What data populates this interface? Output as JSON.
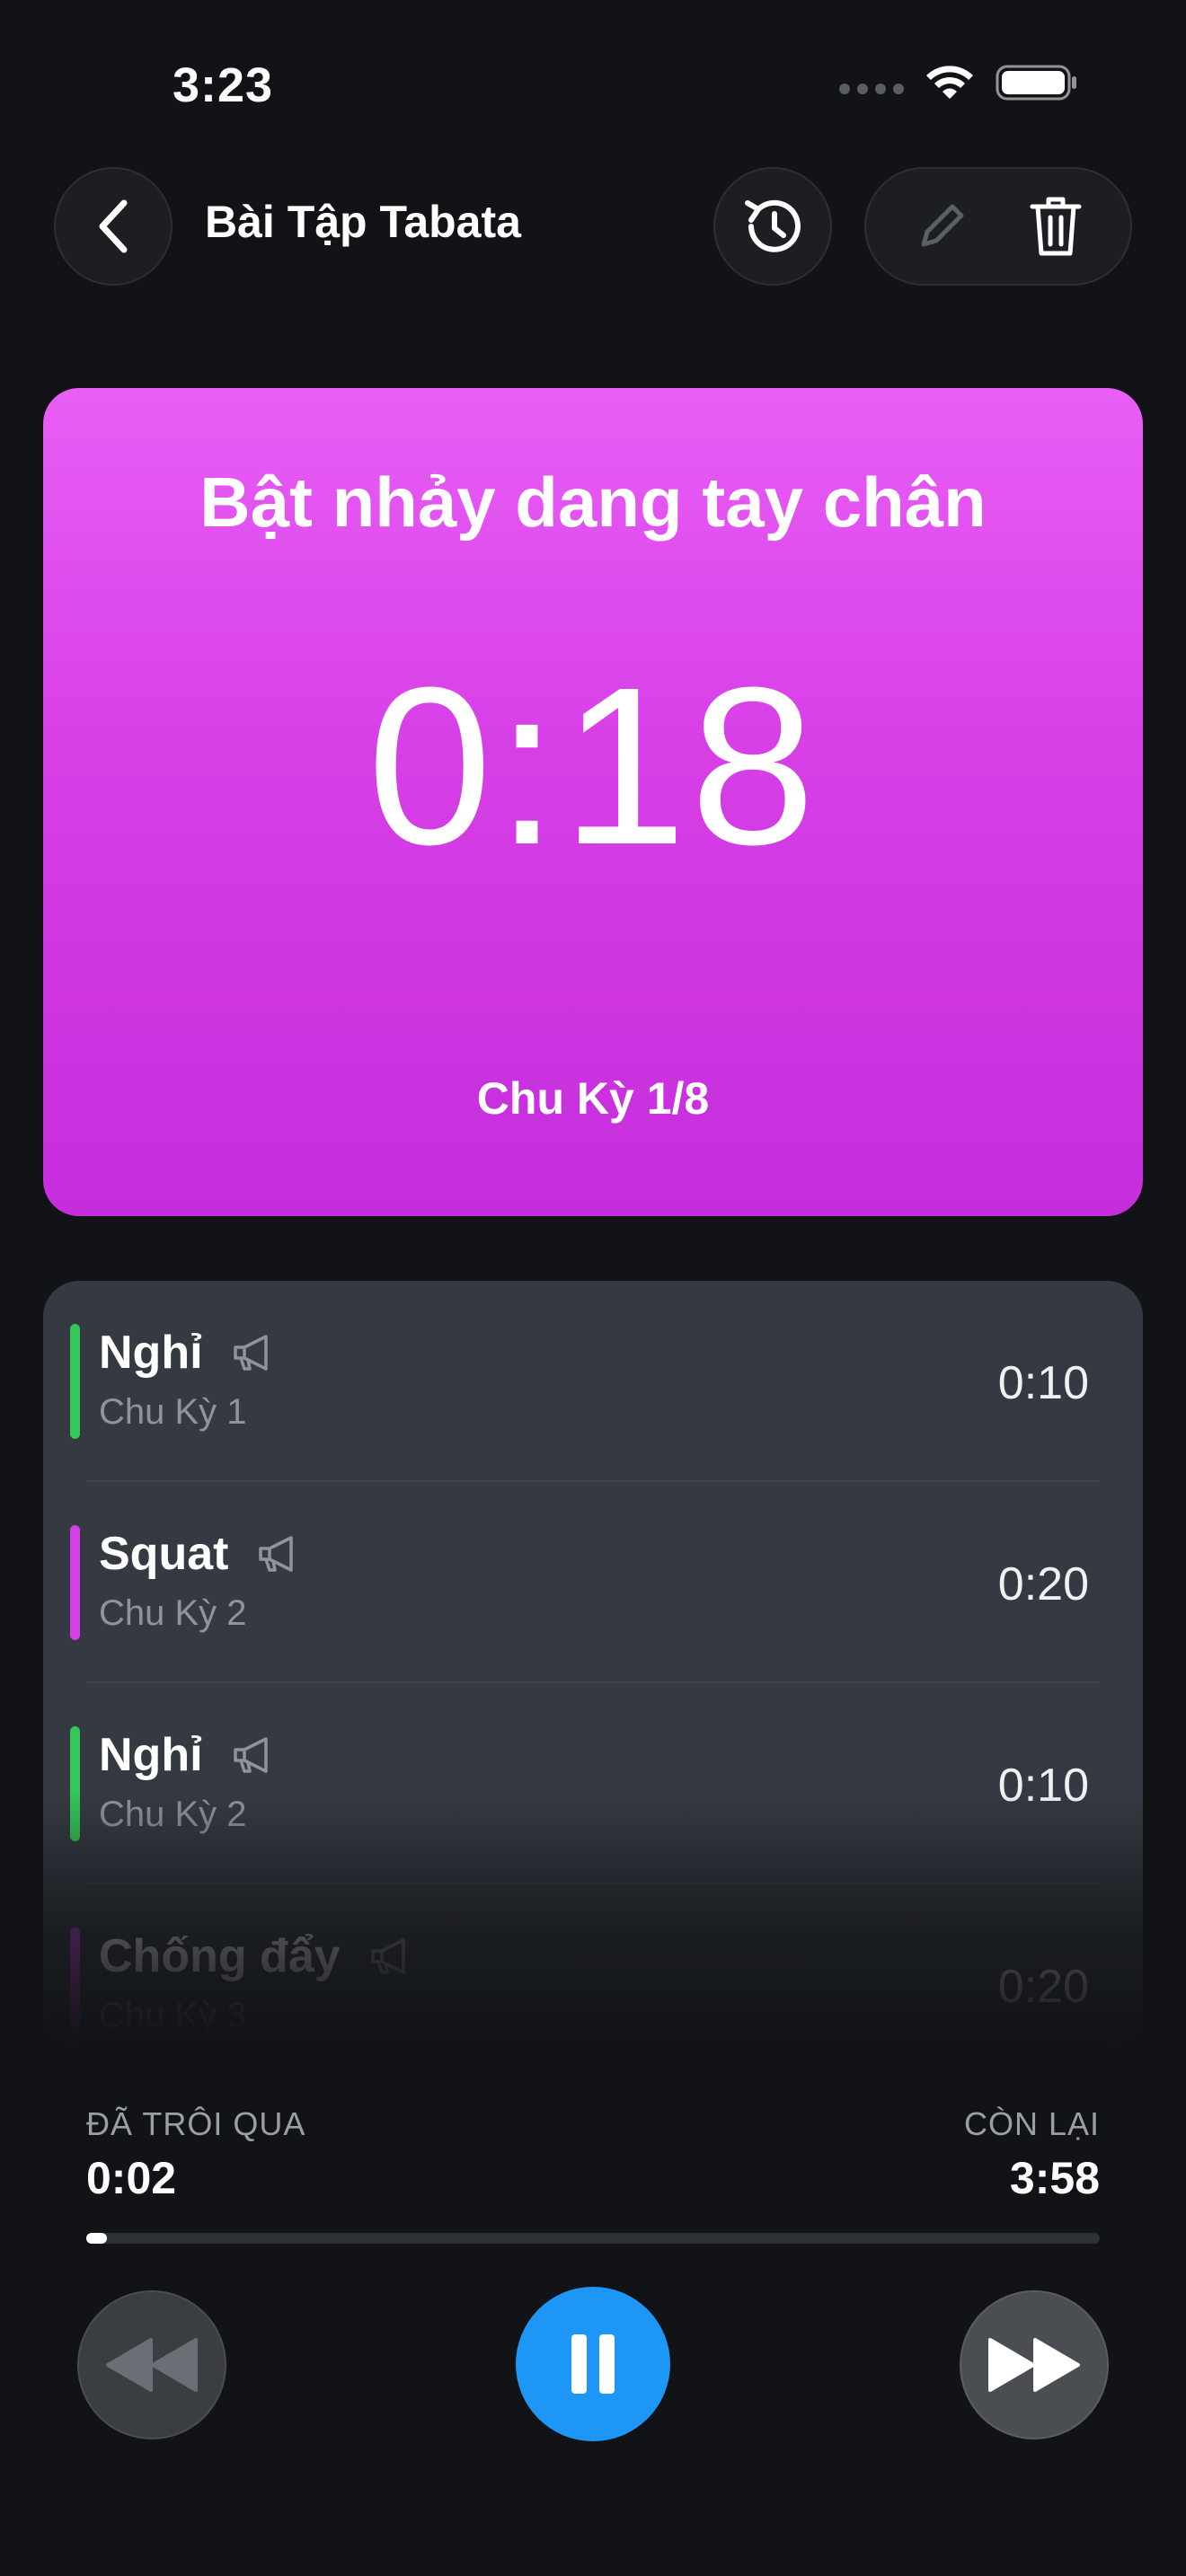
{
  "status_bar": {
    "time": "3:23"
  },
  "header": {
    "title": "Bài Tập Tabata"
  },
  "current": {
    "exercise": "Bật nhảy dang tay chân",
    "timer": "0:18",
    "cycle": "Chu Kỳ 1/8",
    "color": "#d63ee6"
  },
  "queue": [
    {
      "name": "Nghỉ",
      "cycle": "Chu Kỳ 1",
      "duration": "0:10",
      "color": "#34c759"
    },
    {
      "name": "Squat",
      "cycle": "Chu Kỳ 2",
      "duration": "0:20",
      "color": "#d63ee6"
    },
    {
      "name": "Nghỉ",
      "cycle": "Chu Kỳ 2",
      "duration": "0:10",
      "color": "#34c759"
    },
    {
      "name": "Chống đẩy",
      "cycle": "Chu Kỳ 3",
      "duration": "0:20",
      "color": "#d63ee6"
    }
  ],
  "progress": {
    "elapsed_label": "ĐÃ TRÔI QUA",
    "elapsed": "0:02",
    "remaining_label": "CÒN LẠI",
    "remaining": "3:58",
    "fraction": 0.02
  },
  "colors": {
    "accent": "#1e96f5",
    "work": "#d63ee6",
    "rest": "#34c759"
  }
}
